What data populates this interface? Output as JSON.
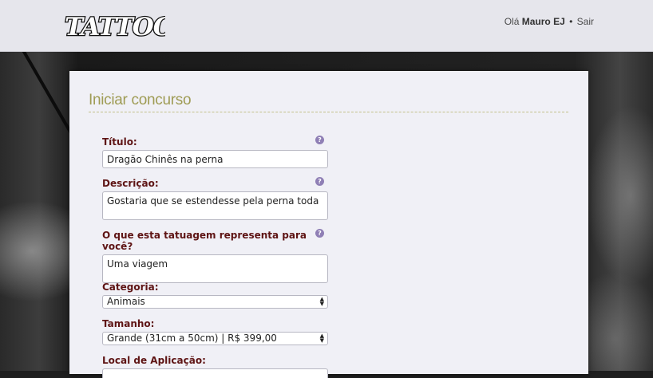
{
  "header": {
    "logo_text": "TATTOO",
    "greeting": "Olá",
    "user_name": "Mauro EJ",
    "separator": "•",
    "logout_label": "Sair"
  },
  "page": {
    "title": "Iniciar concurso"
  },
  "form": {
    "titulo": {
      "label": "Título:",
      "value": "Dragão Chinês na perna",
      "help": "?"
    },
    "descricao": {
      "label": "Descrição:",
      "value": "Gostaria que se estendesse pela perna toda",
      "help": "?"
    },
    "representa": {
      "label": "O que esta tatuagem representa para você?",
      "value": "Uma viagem",
      "help": "?"
    },
    "categoria": {
      "label": "Categoria:",
      "value": "Animais"
    },
    "tamanho": {
      "label": "Tamanho:",
      "value": "Grande (31cm a 50cm) | R$ 399,00"
    },
    "local": {
      "label": "Local de Aplicação:"
    }
  },
  "colors": {
    "title": "#9f9c55",
    "label": "#5e1414",
    "help_badge": "#8f7fb5",
    "topbar": "#e6e6ec"
  }
}
